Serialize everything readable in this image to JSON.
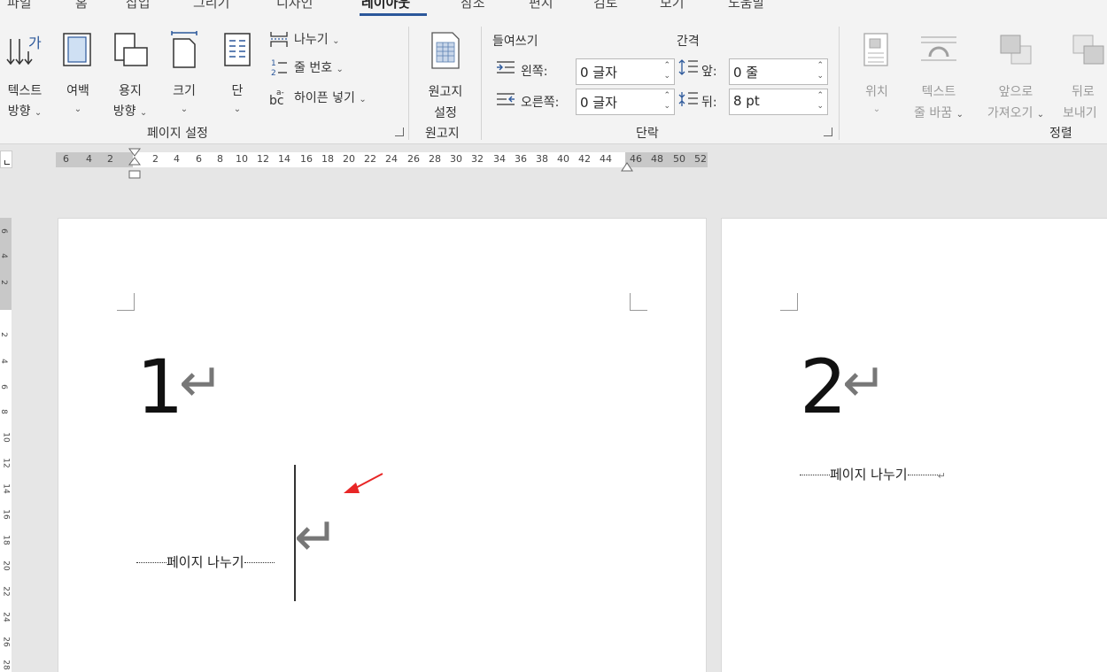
{
  "tabs": [
    "파일",
    "홈",
    "삽입",
    "그리기",
    "디자인",
    "레이아웃",
    "참조",
    "편지",
    "검토",
    "보기",
    "도움말"
  ],
  "active_tab": "레이아웃",
  "page_setup": {
    "text_direction": [
      "텍스트",
      "방향"
    ],
    "margins": "여백",
    "orientation": [
      "용지",
      "방향"
    ],
    "size": "크기",
    "columns": "단",
    "breaks": "나누기",
    "line_numbers": "줄 번호",
    "hyphenation": "하이픈 넣기",
    "group_label": "페이지 설정"
  },
  "manuscript": {
    "settings": [
      "원고지",
      "설정"
    ],
    "group_label": "원고지"
  },
  "paragraph": {
    "indent_title": "들여쓰기",
    "spacing_title": "간격",
    "left_label": "왼쪽:",
    "left_value": "0 글자",
    "right_label": "오른쪽:",
    "right_value": "0 글자",
    "before_label": "앞:",
    "before_value": "0 줄",
    "after_label": "뒤:",
    "after_value": "8 pt",
    "group_label": "단락"
  },
  "arrange": {
    "position": "위치",
    "wrap_text": [
      "텍스트",
      "줄 바꿈"
    ],
    "bring_forward": [
      "앞으로",
      "가져오기"
    ],
    "send_backward": [
      "뒤로",
      "보내기"
    ],
    "group_label": "정렬"
  },
  "ruler": {
    "left_ticks": [
      "6",
      "4",
      "2"
    ],
    "ticks": [
      "2",
      "4",
      "6",
      "8",
      "10",
      "12",
      "14",
      "16",
      "18",
      "20",
      "22",
      "24",
      "26",
      "28",
      "30",
      "32",
      "34",
      "36",
      "38",
      "40",
      "42",
      "44",
      "46",
      "48",
      "50",
      "52"
    ],
    "vticks_top": [
      "6",
      "4",
      "2"
    ],
    "vticks": [
      "2",
      "4",
      "6",
      "8",
      "10",
      "12",
      "14",
      "16",
      "18",
      "20",
      "22",
      "24",
      "26",
      "28"
    ]
  },
  "document": {
    "page1_number": "1",
    "page2_number": "2",
    "return_mark": "↵",
    "page_break": "페이지 나누기"
  },
  "colors": {
    "accent": "#2b579a",
    "annotation_arrow": "#e82626"
  }
}
